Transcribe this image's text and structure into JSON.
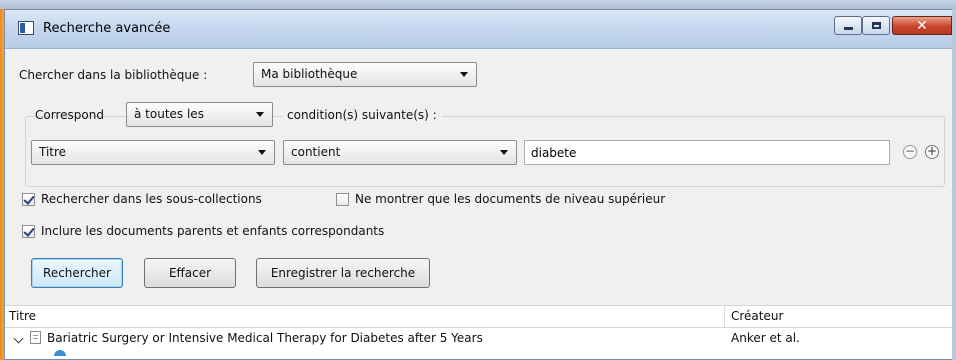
{
  "window": {
    "title": "Recherche avancée",
    "accent": "#e98b1a"
  },
  "search": {
    "library_label": "Chercher dans la bibliothèque :",
    "library_value": "Ma bibliothèque",
    "match_label": "Correspond",
    "match_value": "à toutes les",
    "conditions_label": "condition(s) suivante(s) :",
    "condition": {
      "field": "Titre",
      "operator": "contient",
      "value": "diabete"
    }
  },
  "options": {
    "subcollections": {
      "label": "Rechercher dans les sous-collections",
      "checked": true
    },
    "top_level_only": {
      "label": "Ne montrer que les documents de niveau supérieur",
      "checked": false
    },
    "include_parents": {
      "label": "Inclure les documents parents et enfants correspondants",
      "checked": true
    }
  },
  "buttons": {
    "search": "Rechercher",
    "clear": "Effacer",
    "save": "Enregistrer la recherche"
  },
  "results": {
    "columns": [
      "Titre",
      "Créateur"
    ],
    "rows": [
      {
        "title": "Bariatric Surgery or Intensive Medical Therapy for Diabetes after 5 Years",
        "creator": "Anker et al."
      }
    ]
  },
  "icons": {
    "window_icon": "window-icon",
    "remove_condition": "minus-circle-icon",
    "add_condition": "plus-circle-icon",
    "document": "document-icon",
    "expand": "chevron-down-icon"
  }
}
